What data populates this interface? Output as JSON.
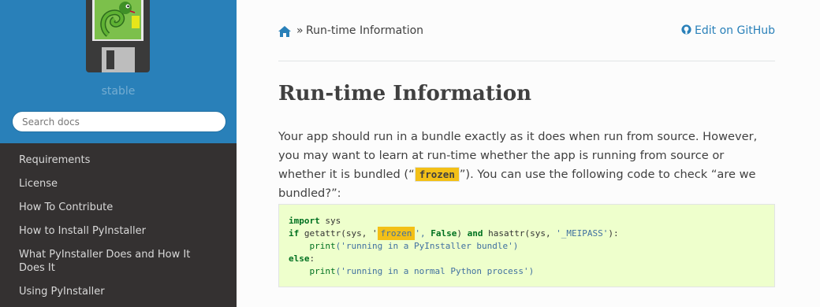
{
  "sidebar": {
    "logo_icon": "pyinstaller-floppy-snake-logo",
    "version": "stable",
    "search_placeholder": "Search docs",
    "items": [
      {
        "label": "Requirements"
      },
      {
        "label": "License"
      },
      {
        "label": "How To Contribute"
      },
      {
        "label": "How to Install PyInstaller"
      },
      {
        "label": "What PyInstaller Does and How It Does It"
      },
      {
        "label": "Using PyInstaller"
      }
    ]
  },
  "breadcrumbs": {
    "home_icon": "home-icon",
    "separator": "»",
    "current": "Run-time Information",
    "edit_link": "Edit on GitHub",
    "edit_icon": "github-icon"
  },
  "page": {
    "title": "Run-time Information",
    "para_before": "Your app should run in a bundle exactly as it does when run from source. However, you may want to learn at run-time whether the app is running from source or whether it is bundled (“",
    "para_literal": "frozen",
    "para_after": "”). You can use the following code to check “are we bundled?”:"
  },
  "code": {
    "line1_kw": "import",
    "line1_rest": " sys",
    "line2_kw": "if",
    "line2_a": " getattr(sys, '",
    "line2_hl": "frozen",
    "line2_b": "', ",
    "line2_false": "False",
    "line2_c": ") ",
    "line2_and": "and",
    "line2_d": " hasattr(sys, ",
    "line2_str": "'_MEIPASS'",
    "line2_e": "):",
    "line3_indent": "    ",
    "line3_fn": "print",
    "line3_str": "('running in a PyInstaller bundle')",
    "line4_kw": "else",
    "line4_rest": ":",
    "line5_indent": "    ",
    "line5_fn": "print",
    "line5_str": "('running in a normal Python process')"
  },
  "colors": {
    "sidebar_top": "#2980b9",
    "sidebar_bg": "#343131",
    "link": "#2980b9",
    "highlight": "#f3c017",
    "code_bg": "#eeffcc"
  }
}
